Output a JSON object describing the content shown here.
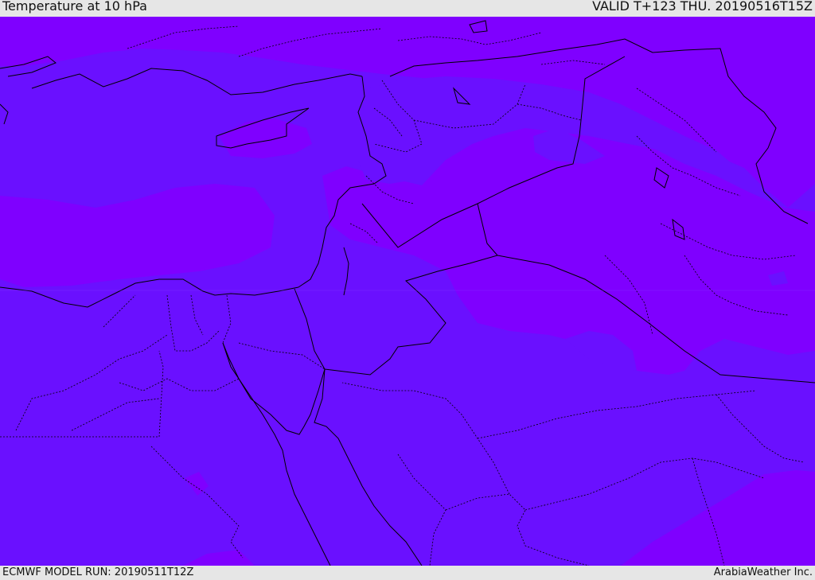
{
  "header": {
    "title": "Temperature at 10 hPa",
    "valid": "VALID T+123 THU. 20190516T15Z"
  },
  "footer": {
    "model_run": "ECMWF MODEL RUN: 20190511T12Z",
    "credit": "ArabiaWeather Inc."
  },
  "colors": {
    "base_fill": "#6a10ff",
    "warm_fill": "#7f00ff",
    "border": "#000000",
    "background": "#e6e6e6"
  }
}
